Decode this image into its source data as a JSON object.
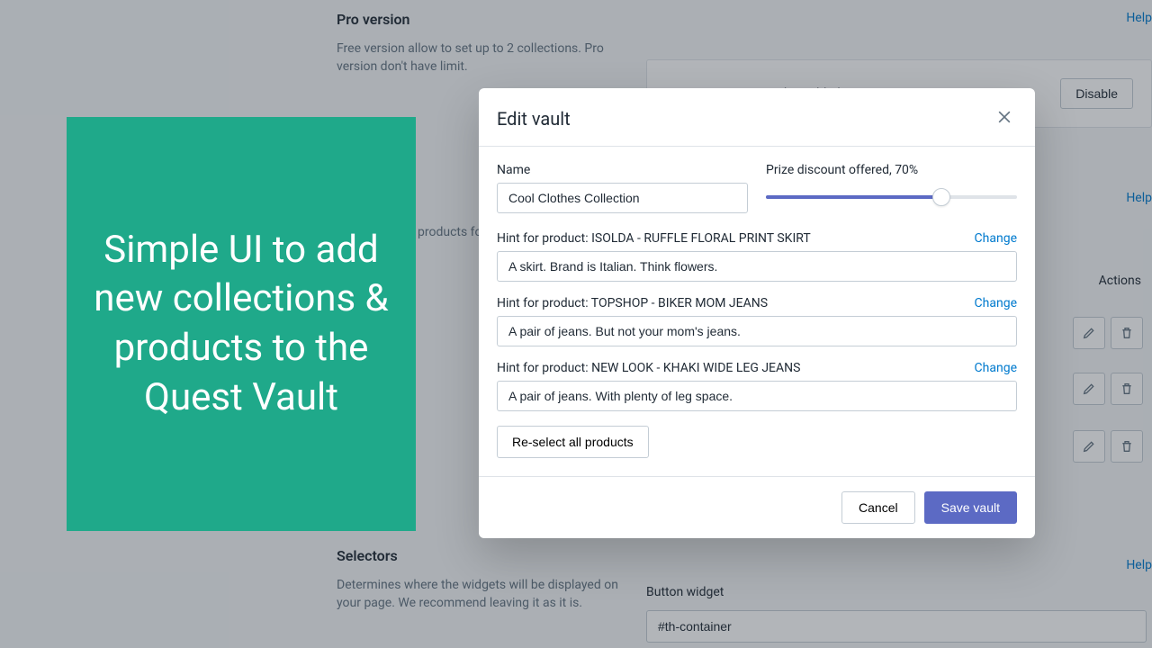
{
  "page": {
    "pro_section": {
      "title": "Pro version",
      "desc": "Free version allow to set up to 2 collections. Pro version don't have limit."
    },
    "collections_fragment": " products fo",
    "selectors_section": {
      "title": "Selectors",
      "desc": "Determines where the widgets will be displayed on your page. We recommend leaving it as it is."
    },
    "help_label": "Help",
    "pro_banner": {
      "text": "Pro version is currently enabled.",
      "disable_label": "Disable"
    },
    "actions_header": "Actions",
    "button_widget": {
      "label": "Button widget",
      "value": "#th-container"
    }
  },
  "promo": {
    "text": "Simple UI to add new collections & products to the Quest Vault"
  },
  "modal": {
    "title": "Edit vault",
    "name_label": "Name",
    "name_value": "Cool Clothes Collection",
    "discount_label": "Prize discount offered, 70%",
    "discount_percent": 70,
    "hints": [
      {
        "label": "Hint for product: ISOLDA - RUFFLE FLORAL PRINT SKIRT",
        "value": "A skirt. Brand is Italian. Think flowers.",
        "change": "Change"
      },
      {
        "label": "Hint for product: TOPSHOP - BIKER MOM JEANS",
        "value": "A pair of jeans. But not your mom's jeans.",
        "change": "Change"
      },
      {
        "label": "Hint for product: NEW LOOK - KHAKI WIDE LEG JEANS",
        "value": "A pair of jeans. With plenty of leg space.",
        "change": "Change"
      }
    ],
    "reselect_label": "Re-select all products",
    "cancel_label": "Cancel",
    "save_label": "Save vault"
  }
}
